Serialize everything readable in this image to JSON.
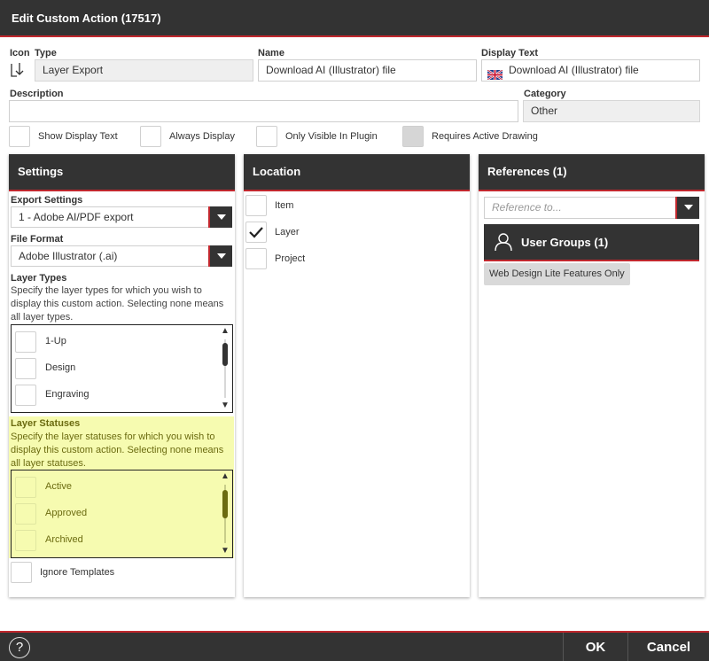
{
  "dialog": {
    "title": "Edit Custom Action (17517)"
  },
  "form": {
    "icon_label": "Icon",
    "type_label": "Type",
    "type_value": "Layer Export",
    "name_label": "Name",
    "name_value": "Download AI (Illustrator) file",
    "display_text_label": "Display Text",
    "display_text_value": "Download AI (Illustrator) file",
    "description_label": "Description",
    "description_value": "",
    "category_label": "Category",
    "category_value": "Other"
  },
  "options": {
    "show_display_text": "Show Display Text",
    "always_display": "Always Display",
    "only_visible_in_plugin": "Only Visible In Plugin",
    "requires_active_drawing": "Requires Active Drawing"
  },
  "settings": {
    "header": "Settings",
    "export_settings_label": "Export Settings",
    "export_settings_value": "1 - Adobe AI/PDF export",
    "file_format_label": "File Format",
    "file_format_value": "Adobe Illustrator (.ai)",
    "layer_types_label": "Layer Types",
    "layer_types_desc": "Specify the layer types for which you wish to display this custom action. Selecting none means all layer types.",
    "layer_types": [
      "1-Up",
      "Design",
      "Engraving"
    ],
    "layer_statuses_label": "Layer Statuses",
    "layer_statuses_desc": "Specify the layer statuses for which you wish to display this custom action. Selecting none means all layer statuses.",
    "layer_statuses": [
      "Active",
      "Approved",
      "Archived"
    ],
    "ignore_templates": "Ignore Templates"
  },
  "location": {
    "header": "Location",
    "items": [
      {
        "label": "Item",
        "checked": false
      },
      {
        "label": "Layer",
        "checked": true
      },
      {
        "label": "Project",
        "checked": false
      }
    ]
  },
  "references": {
    "header": "References (1)",
    "placeholder": "Reference to...",
    "user_groups_header": "User Groups (1)",
    "tags": [
      "Web Design Lite Features Only"
    ]
  },
  "footer": {
    "help": "?",
    "ok": "OK",
    "cancel": "Cancel"
  },
  "colors": {
    "header_bg": "#333333",
    "accent": "#c0272d",
    "highlight": "#f6fbb0"
  }
}
